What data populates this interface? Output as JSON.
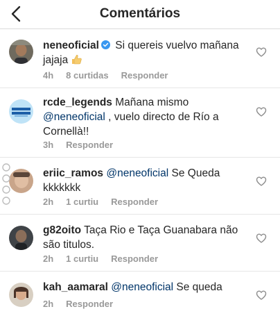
{
  "header": {
    "title": "Comentários"
  },
  "comments": [
    {
      "username": "neneoficial",
      "verified": true,
      "text": "Si quereis vuelvo mañana jajaja",
      "emoji": "thumbs-up-icon",
      "time": "4h",
      "likes": "8 curtidas",
      "reply": "Responder"
    },
    {
      "username": "rcde_legends",
      "text": "Mañana mismo",
      "mention": "@neneoficial",
      "text_after": ", vuelo directo de Río a Cornellà!!",
      "time": "3h",
      "reply": "Responder"
    },
    {
      "username": "eriic_ramos",
      "mention": "@neneoficial",
      "text_after": "Se Queda kkkkkkk",
      "time": "2h",
      "likes": "1 curtiu",
      "reply": "Responder"
    },
    {
      "username": "g82oito",
      "text": "Taça Rio e Taça Guanabara não são titulos.",
      "time": "2h",
      "likes": "1 curtiu",
      "reply": "Responder"
    },
    {
      "username": "kah_aamaral",
      "mention": "@neneoficial",
      "text_after": "Se queda",
      "time": "2h",
      "reply": "Responder"
    }
  ],
  "colors": {
    "text": "#262626",
    "meta": "#999999",
    "mention": "#003569",
    "verified": "#3897f0",
    "divider": "#e6e6e6"
  }
}
